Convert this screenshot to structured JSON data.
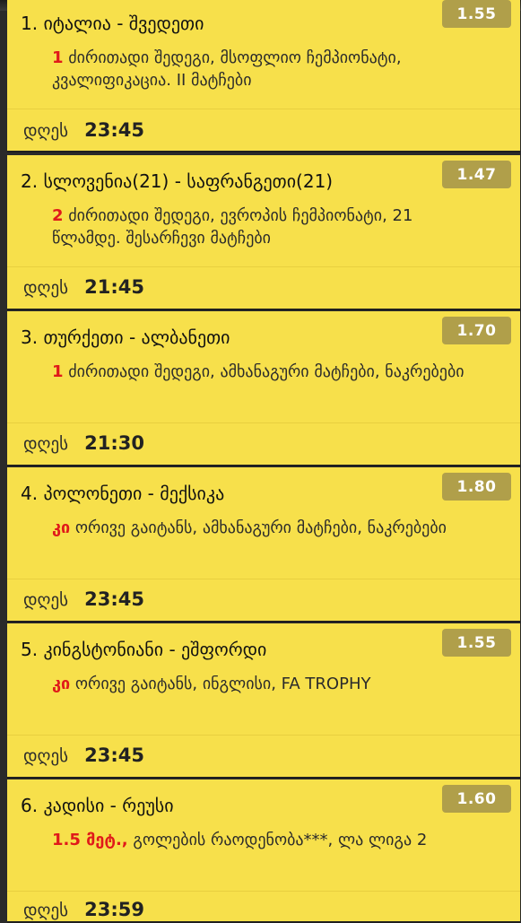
{
  "matches": [
    {
      "num": "1.",
      "teams": "იტალია - შვედეთი",
      "odds": "1.55",
      "highlight": "1",
      "desc": "ძირითადი შედეგი, მსოფლიო ჩემპიონატი, კვალიფიკაცია. II მატჩები",
      "day": "დღეს",
      "time": "23:45"
    },
    {
      "num": "2.",
      "teams": "სლოვენია(21) - საფრანგეთი(21)",
      "odds": "1.47",
      "highlight": "2",
      "desc": "ძირითადი შედეგი, ევროპის ჩემპიონატი, 21 წლამდე. შესარჩევი მატჩები",
      "day": "დღეს",
      "time": "21:45"
    },
    {
      "num": "3.",
      "teams": "თურქეთი - ალბანეთი",
      "odds": "1.70",
      "highlight": "1",
      "desc": "ძირითადი შედეგი, ამხანაგური მატჩები, ნაკრებები",
      "day": "დღეს",
      "time": "21:30"
    },
    {
      "num": "4.",
      "teams": "პოლონეთი - მექსიკა",
      "odds": "1.80",
      "highlight": "კი",
      "desc": "ორივე გაიტანს, ამხანაგური მატჩები, ნაკრებები",
      "day": "დღეს",
      "time": "23:45"
    },
    {
      "num": "5.",
      "teams": "კინგსტონიანი - ეშფორდი",
      "odds": "1.55",
      "highlight": "კი",
      "desc": "ორივე გაიტანს, ინგლისი, FA TROPHY",
      "day": "დღეს",
      "time": "23:45"
    },
    {
      "num": "6.",
      "teams": "კადისი - რეუსი",
      "odds": "1.60",
      "highlight": "1.5 მეტ.,",
      "desc": "გოლების რაოდენობა***, ლა ლიგა 2",
      "day": "დღეს",
      "time": "23:59"
    }
  ]
}
